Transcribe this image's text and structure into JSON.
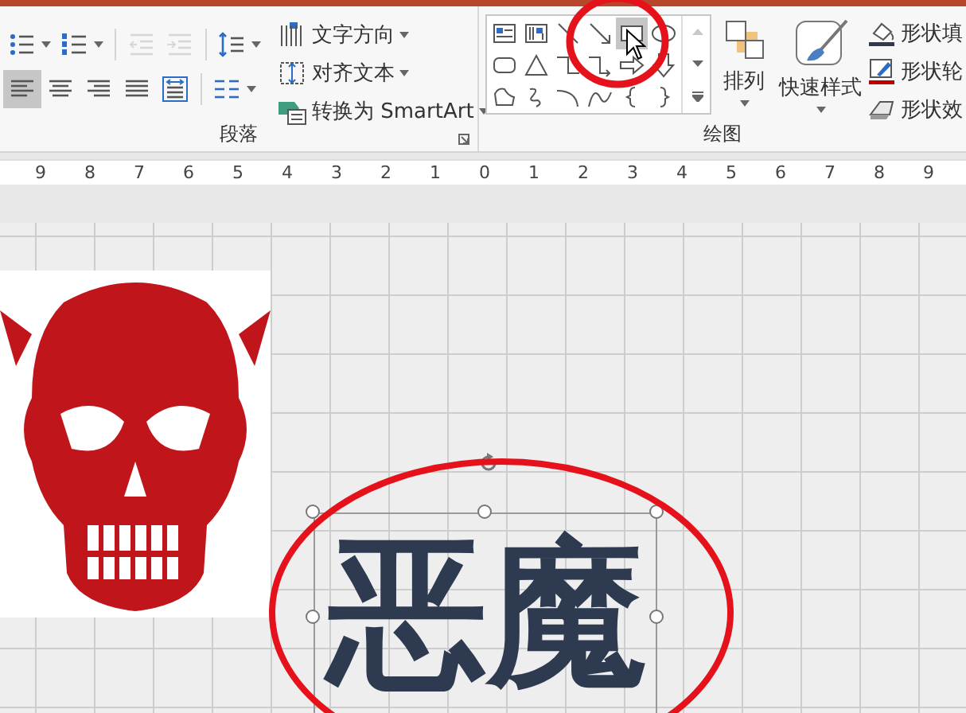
{
  "paragraph": {
    "label": "段落",
    "rows": [
      [
        {
          "kind": "bullets",
          "dropdown": true,
          "selected": false,
          "disabled": false
        },
        {
          "kind": "numbering",
          "dropdown": true,
          "selected": false,
          "disabled": false
        },
        {
          "kind": "sep"
        },
        {
          "kind": "outdent",
          "dropdown": false,
          "selected": false,
          "disabled": true
        },
        {
          "kind": "indent",
          "dropdown": false,
          "selected": false,
          "disabled": true
        },
        {
          "kind": "sep"
        },
        {
          "kind": "line-spacing",
          "dropdown": true,
          "selected": false,
          "disabled": false
        }
      ],
      [
        {
          "kind": "align-left",
          "dropdown": false,
          "selected": true,
          "disabled": false
        },
        {
          "kind": "align-center",
          "dropdown": false,
          "selected": false,
          "disabled": false
        },
        {
          "kind": "align-right",
          "dropdown": false,
          "selected": false,
          "disabled": false
        },
        {
          "kind": "justify",
          "dropdown": false,
          "selected": false,
          "disabled": false
        },
        {
          "kind": "distribute",
          "dropdown": false,
          "selected": false,
          "disabled": false
        },
        {
          "kind": "sep"
        },
        {
          "kind": "columns",
          "dropdown": true,
          "selected": false,
          "disabled": false
        }
      ]
    ],
    "commands": [
      {
        "kind": "text-direction",
        "label": "文字方向"
      },
      {
        "kind": "align-text",
        "label": "对齐文本"
      },
      {
        "kind": "smartart",
        "label": "转换为 SmartArt"
      }
    ]
  },
  "drawing": {
    "label": "绘图",
    "shapes": [
      {
        "kind": "textbox",
        "selected": false
      },
      {
        "kind": "vtextbox",
        "selected": false
      },
      {
        "kind": "line",
        "selected": false
      },
      {
        "kind": "arrow",
        "selected": false
      },
      {
        "kind": "rect",
        "selected": true
      },
      {
        "kind": "oval",
        "selected": false
      },
      {
        "kind": "roundrect",
        "selected": false
      },
      {
        "kind": "triangle",
        "selected": false
      },
      {
        "kind": "elbow",
        "selected": false
      },
      {
        "kind": "elbow-arrow",
        "selected": false
      },
      {
        "kind": "right-arrow",
        "selected": false
      },
      {
        "kind": "down-arrow",
        "selected": false
      },
      {
        "kind": "freeform",
        "selected": false
      },
      {
        "kind": "scribble",
        "selected": false
      },
      {
        "kind": "arc",
        "selected": false
      },
      {
        "kind": "curve",
        "selected": false
      },
      {
        "kind": "lbrace",
        "selected": false
      },
      {
        "kind": "rbrace",
        "selected": false
      }
    ],
    "arrange": "排列",
    "quick_styles": "快速样式",
    "shape_commands": [
      {
        "kind": "fill",
        "label": "形状填"
      },
      {
        "kind": "outline",
        "label": "形状轮"
      },
      {
        "kind": "effects",
        "label": "形状效"
      }
    ]
  },
  "ruler": [
    "9",
    "8",
    "7",
    "6",
    "5",
    "4",
    "3",
    "2",
    "1",
    "0",
    "1",
    "2",
    "3",
    "4",
    "5",
    "6",
    "7",
    "8",
    "9"
  ],
  "slide": {
    "title": "恶魔",
    "title_selected": true
  }
}
